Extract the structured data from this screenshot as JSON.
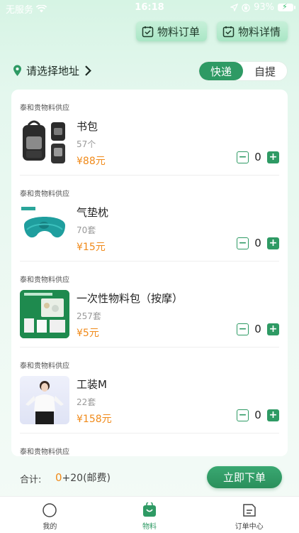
{
  "status_bar": {
    "carrier": "无服务",
    "time": "16:18",
    "battery": "93%"
  },
  "top_buttons": [
    {
      "label": "物料订单",
      "icon": "calendar-check-icon"
    },
    {
      "label": "物料详情",
      "icon": "calendar-check-icon"
    }
  ],
  "address": {
    "label": "请选择地址",
    "icon": "location-pin-icon"
  },
  "delivery": {
    "options": [
      "快递",
      "自提"
    ],
    "selected": "快递"
  },
  "products": [
    {
      "supplier": "泰和贵物料供应",
      "name": "书包",
      "stock": "57个",
      "price": "¥88元",
      "qty": "0",
      "thumb": "backpack"
    },
    {
      "supplier": "泰和贵物料供应",
      "name": "气垫枕",
      "stock": "70套",
      "price": "¥15元",
      "qty": "0",
      "thumb": "neck-pillow"
    },
    {
      "supplier": "泰和贵物料供应",
      "name": "一次性物料包（按摩）",
      "stock": "257套",
      "price": "¥5元",
      "qty": "0",
      "thumb": "supply-pack"
    },
    {
      "supplier": "泰和贵物料供应",
      "name": "工装M",
      "stock": "22套",
      "price": "¥158元",
      "qty": "0",
      "thumb": "uniform"
    },
    {
      "supplier": "泰和贵物料供应"
    }
  ],
  "stepper": {
    "minus": "−",
    "plus": "+"
  },
  "total": {
    "label": "合计:",
    "amount": "0",
    "shipping": "+20(邮费)",
    "button": "立即下单"
  },
  "tabs": [
    {
      "label": "我的",
      "icon": "user-circle-icon",
      "active": false
    },
    {
      "label": "物料",
      "icon": "shopping-bag-icon",
      "active": true
    },
    {
      "label": "订单中心",
      "icon": "order-list-icon",
      "active": false
    }
  ],
  "colors": {
    "accent": "#2e9a64",
    "price": "#f08a1a"
  }
}
